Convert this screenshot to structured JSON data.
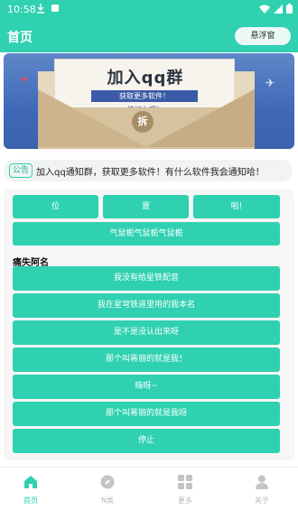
{
  "status_bar": {
    "time": "10:58"
  },
  "app_bar": {
    "title": "首页",
    "float_button": "悬浮窗"
  },
  "banner": {
    "title": "加入qq群",
    "tag": "获取更多软件！",
    "subtitle": "快加入吧！",
    "seal": "拆"
  },
  "notice": {
    "tag": "公告",
    "text": "加入qq通知群，获取更多软件！有什么软件我会通知哈！"
  },
  "top_buttons": [
    "位",
    "置",
    "啦!"
  ],
  "wide_button": "气鼠栀气鼠栀气鼠栀",
  "section_label": "痛失阿名",
  "list_buttons": [
    "我没有给星铁配音",
    "我在星穹铁道里用的我本名",
    "是不是没认出来呀",
    "那个叫蒋丽的就是我！",
    "嗨呀~",
    "那个叫蒋丽的就是我呀",
    "停止"
  ],
  "nav": {
    "items": [
      {
        "label": "首页",
        "icon": "home-icon"
      },
      {
        "label": "N类",
        "icon": "compass-icon"
      },
      {
        "label": "更多",
        "icon": "grid-icon"
      },
      {
        "label": "关于",
        "icon": "user-icon"
      }
    ]
  },
  "colors": {
    "accent": "#2fd1b0",
    "banner_blue": "#4a72bb"
  }
}
